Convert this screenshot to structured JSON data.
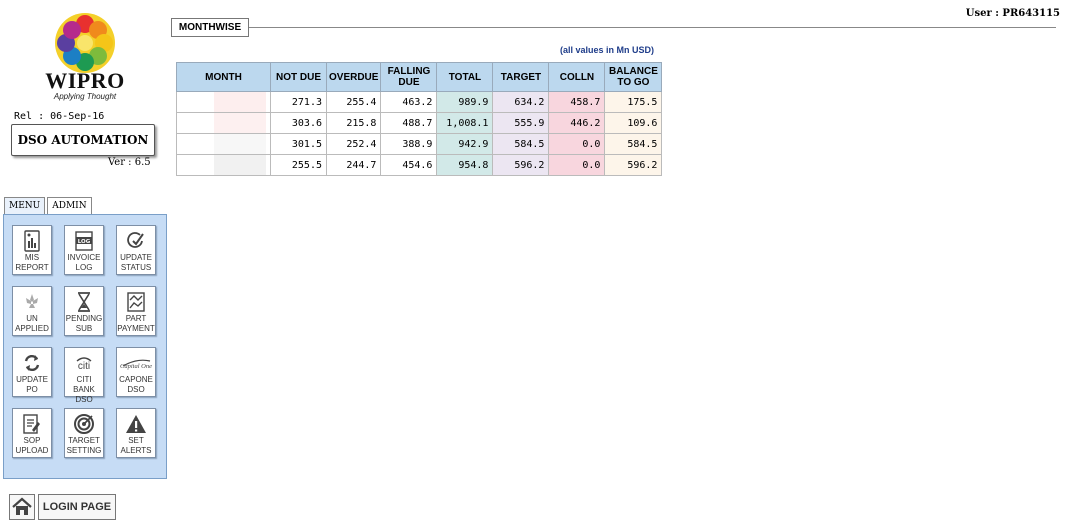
{
  "brand": {
    "name": "WIPRO",
    "tagline": "Applying Thought"
  },
  "sidebar": {
    "rel_label": "Rel :",
    "rel_date": "06-Sep-16",
    "app_title": "DSO AUTOMATION",
    "ver_label": "Ver :",
    "version": "6.5",
    "tabs": [
      {
        "label": "MENU"
      },
      {
        "label": "ADMIN"
      }
    ],
    "tiles": [
      {
        "line1": "MIS",
        "line2": "REPORT",
        "icon": "mis-report-icon"
      },
      {
        "line1": "INVOICE",
        "line2": "LOG",
        "icon": "invoice-log-icon"
      },
      {
        "line1": "UPDATE",
        "line2": "STATUS",
        "icon": "update-status-icon"
      },
      {
        "line1": "UN",
        "line2": "APPLIED",
        "icon": "unapplied-icon"
      },
      {
        "line1": "PENDING",
        "line2": "SUB",
        "icon": "hourglass-icon"
      },
      {
        "line1": "PART",
        "line2": "PAYMENT",
        "icon": "part-payment-icon"
      },
      {
        "line1": "UPDATE",
        "line2": "PO",
        "icon": "refresh-icon"
      },
      {
        "line1": "CITI BANK",
        "line2": "DSO",
        "icon": "citi-logo-icon"
      },
      {
        "line1": "CAPONE",
        "line2": "DSO",
        "icon": "capital-one-logo-icon"
      },
      {
        "line1": "SOP",
        "line2": "UPLOAD",
        "icon": "sop-upload-icon"
      },
      {
        "line1": "TARGET",
        "line2": "SETTING",
        "icon": "target-icon"
      },
      {
        "line1": "SET",
        "line2": "ALERTS",
        "icon": "alert-icon"
      }
    ],
    "login_label": "LOGIN PAGE"
  },
  "header": {
    "user_label": "User :",
    "user_id": "PR643115",
    "section_tab": "MONTHWISE",
    "note": "(all values in Mn USD)"
  },
  "table": {
    "columns": [
      [
        "MONTH"
      ],
      [
        "NOT DUE"
      ],
      [
        "OVERDUE"
      ],
      [
        "FALLING",
        "DUE"
      ],
      [
        "TOTAL"
      ],
      [
        "TARGET"
      ],
      [
        "COLLN"
      ],
      [
        "BALANCE",
        "TO GO"
      ]
    ],
    "rows": [
      {
        "month": "",
        "not_due": "271.3",
        "overdue": "255.4",
        "falling_due": "463.2",
        "total": "989.9",
        "target": "634.2",
        "colln": "458.7",
        "balance": "175.5"
      },
      {
        "month": "",
        "not_due": "303.6",
        "overdue": "215.8",
        "falling_due": "488.7",
        "total": "1,008.1",
        "target": "555.9",
        "colln": "446.2",
        "balance": "109.6"
      },
      {
        "month": "",
        "not_due": "301.5",
        "overdue": "252.4",
        "falling_due": "388.9",
        "total": "942.9",
        "target": "584.5",
        "colln": "0.0",
        "balance": "584.5"
      },
      {
        "month": "",
        "not_due": "255.5",
        "overdue": "244.7",
        "falling_due": "454.6",
        "total": "954.8",
        "target": "596.2",
        "colln": "0.0",
        "balance": "596.2"
      }
    ],
    "month_swatches": [
      "#fdeeee",
      "#fdf0f0",
      "#f7f7f7",
      "#f1f1f1"
    ]
  }
}
